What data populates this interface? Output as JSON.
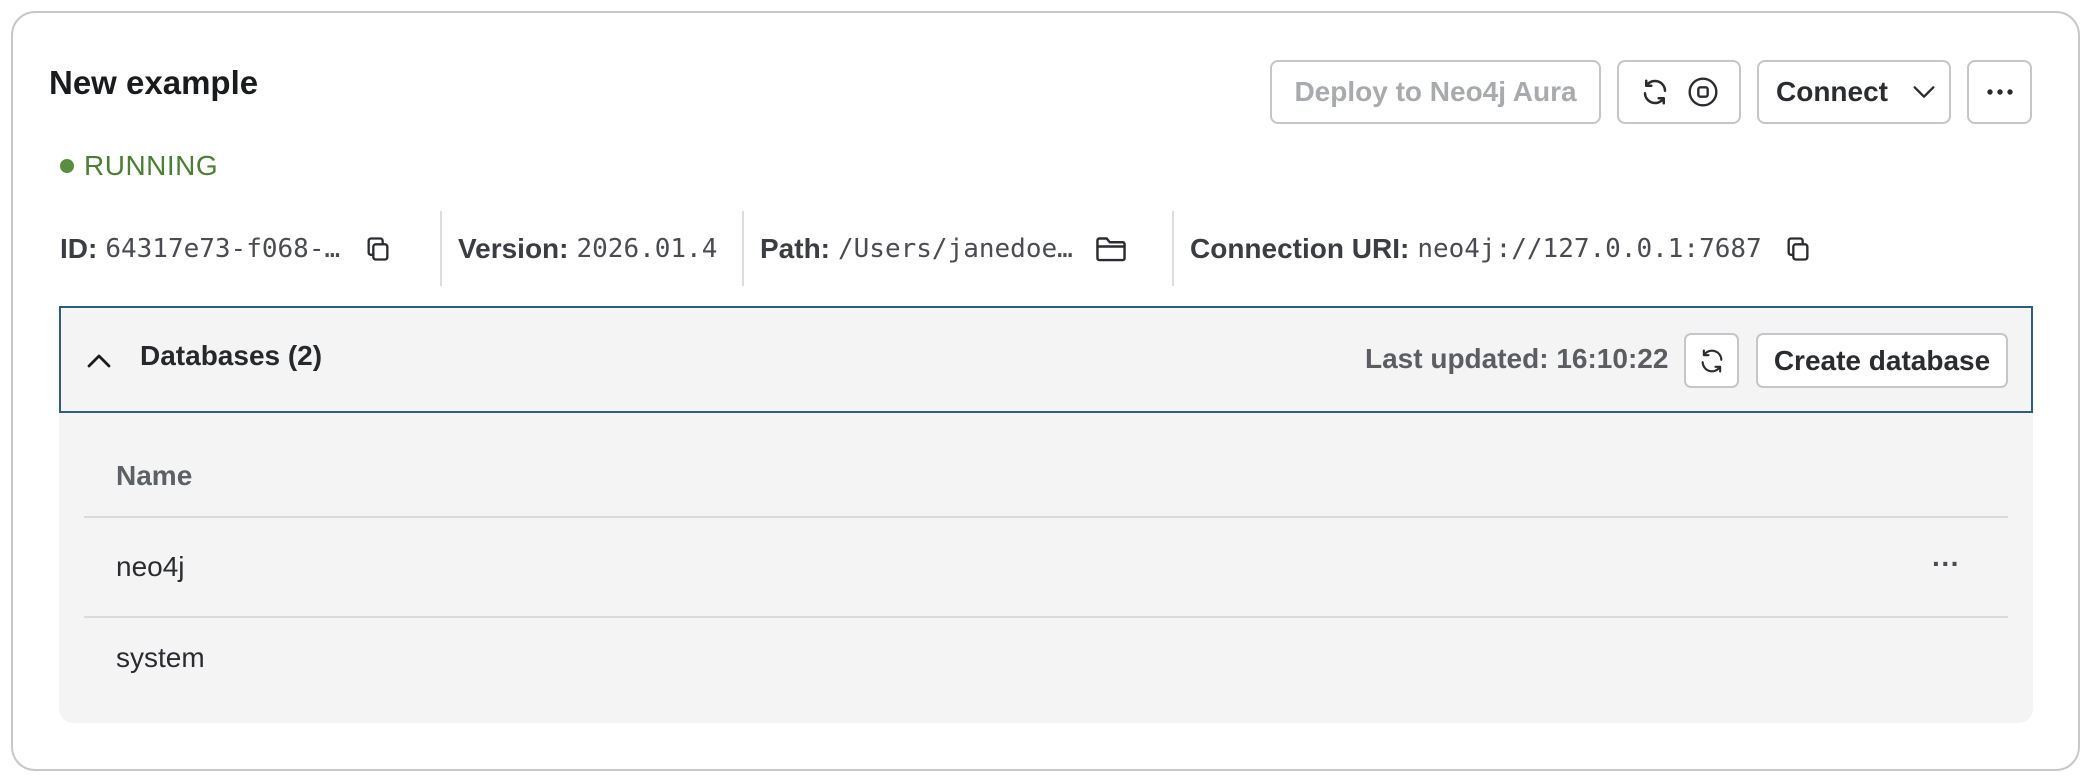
{
  "instance": {
    "title": "New example",
    "status": "RUNNING",
    "colors": {
      "status": "#4c7f35",
      "panel_border": "#2f5d7a"
    }
  },
  "toolbar": {
    "deploy_label": "Deploy to Neo4j Aura",
    "connect_label": "Connect",
    "icons": [
      "refresh-icon",
      "stop-icon",
      "chevron-down-icon",
      "more-icon"
    ]
  },
  "details": {
    "id_label": "ID:",
    "id_value": "64317e73-f068-…",
    "version_label": "Version:",
    "version_value": "2026.01.4",
    "path_label": "Path:",
    "path_value": "/Users/janedoe…",
    "uri_label": "Connection URI:",
    "uri_value": "neo4j://127.0.0.1:7687"
  },
  "databases": {
    "title": "Databases (2)",
    "last_updated": "Last updated: 16:10:22",
    "create_label": "Create database",
    "columns": [
      "Name"
    ],
    "rows": [
      {
        "name": "neo4j",
        "menu": "···"
      },
      {
        "name": "system"
      }
    ]
  }
}
